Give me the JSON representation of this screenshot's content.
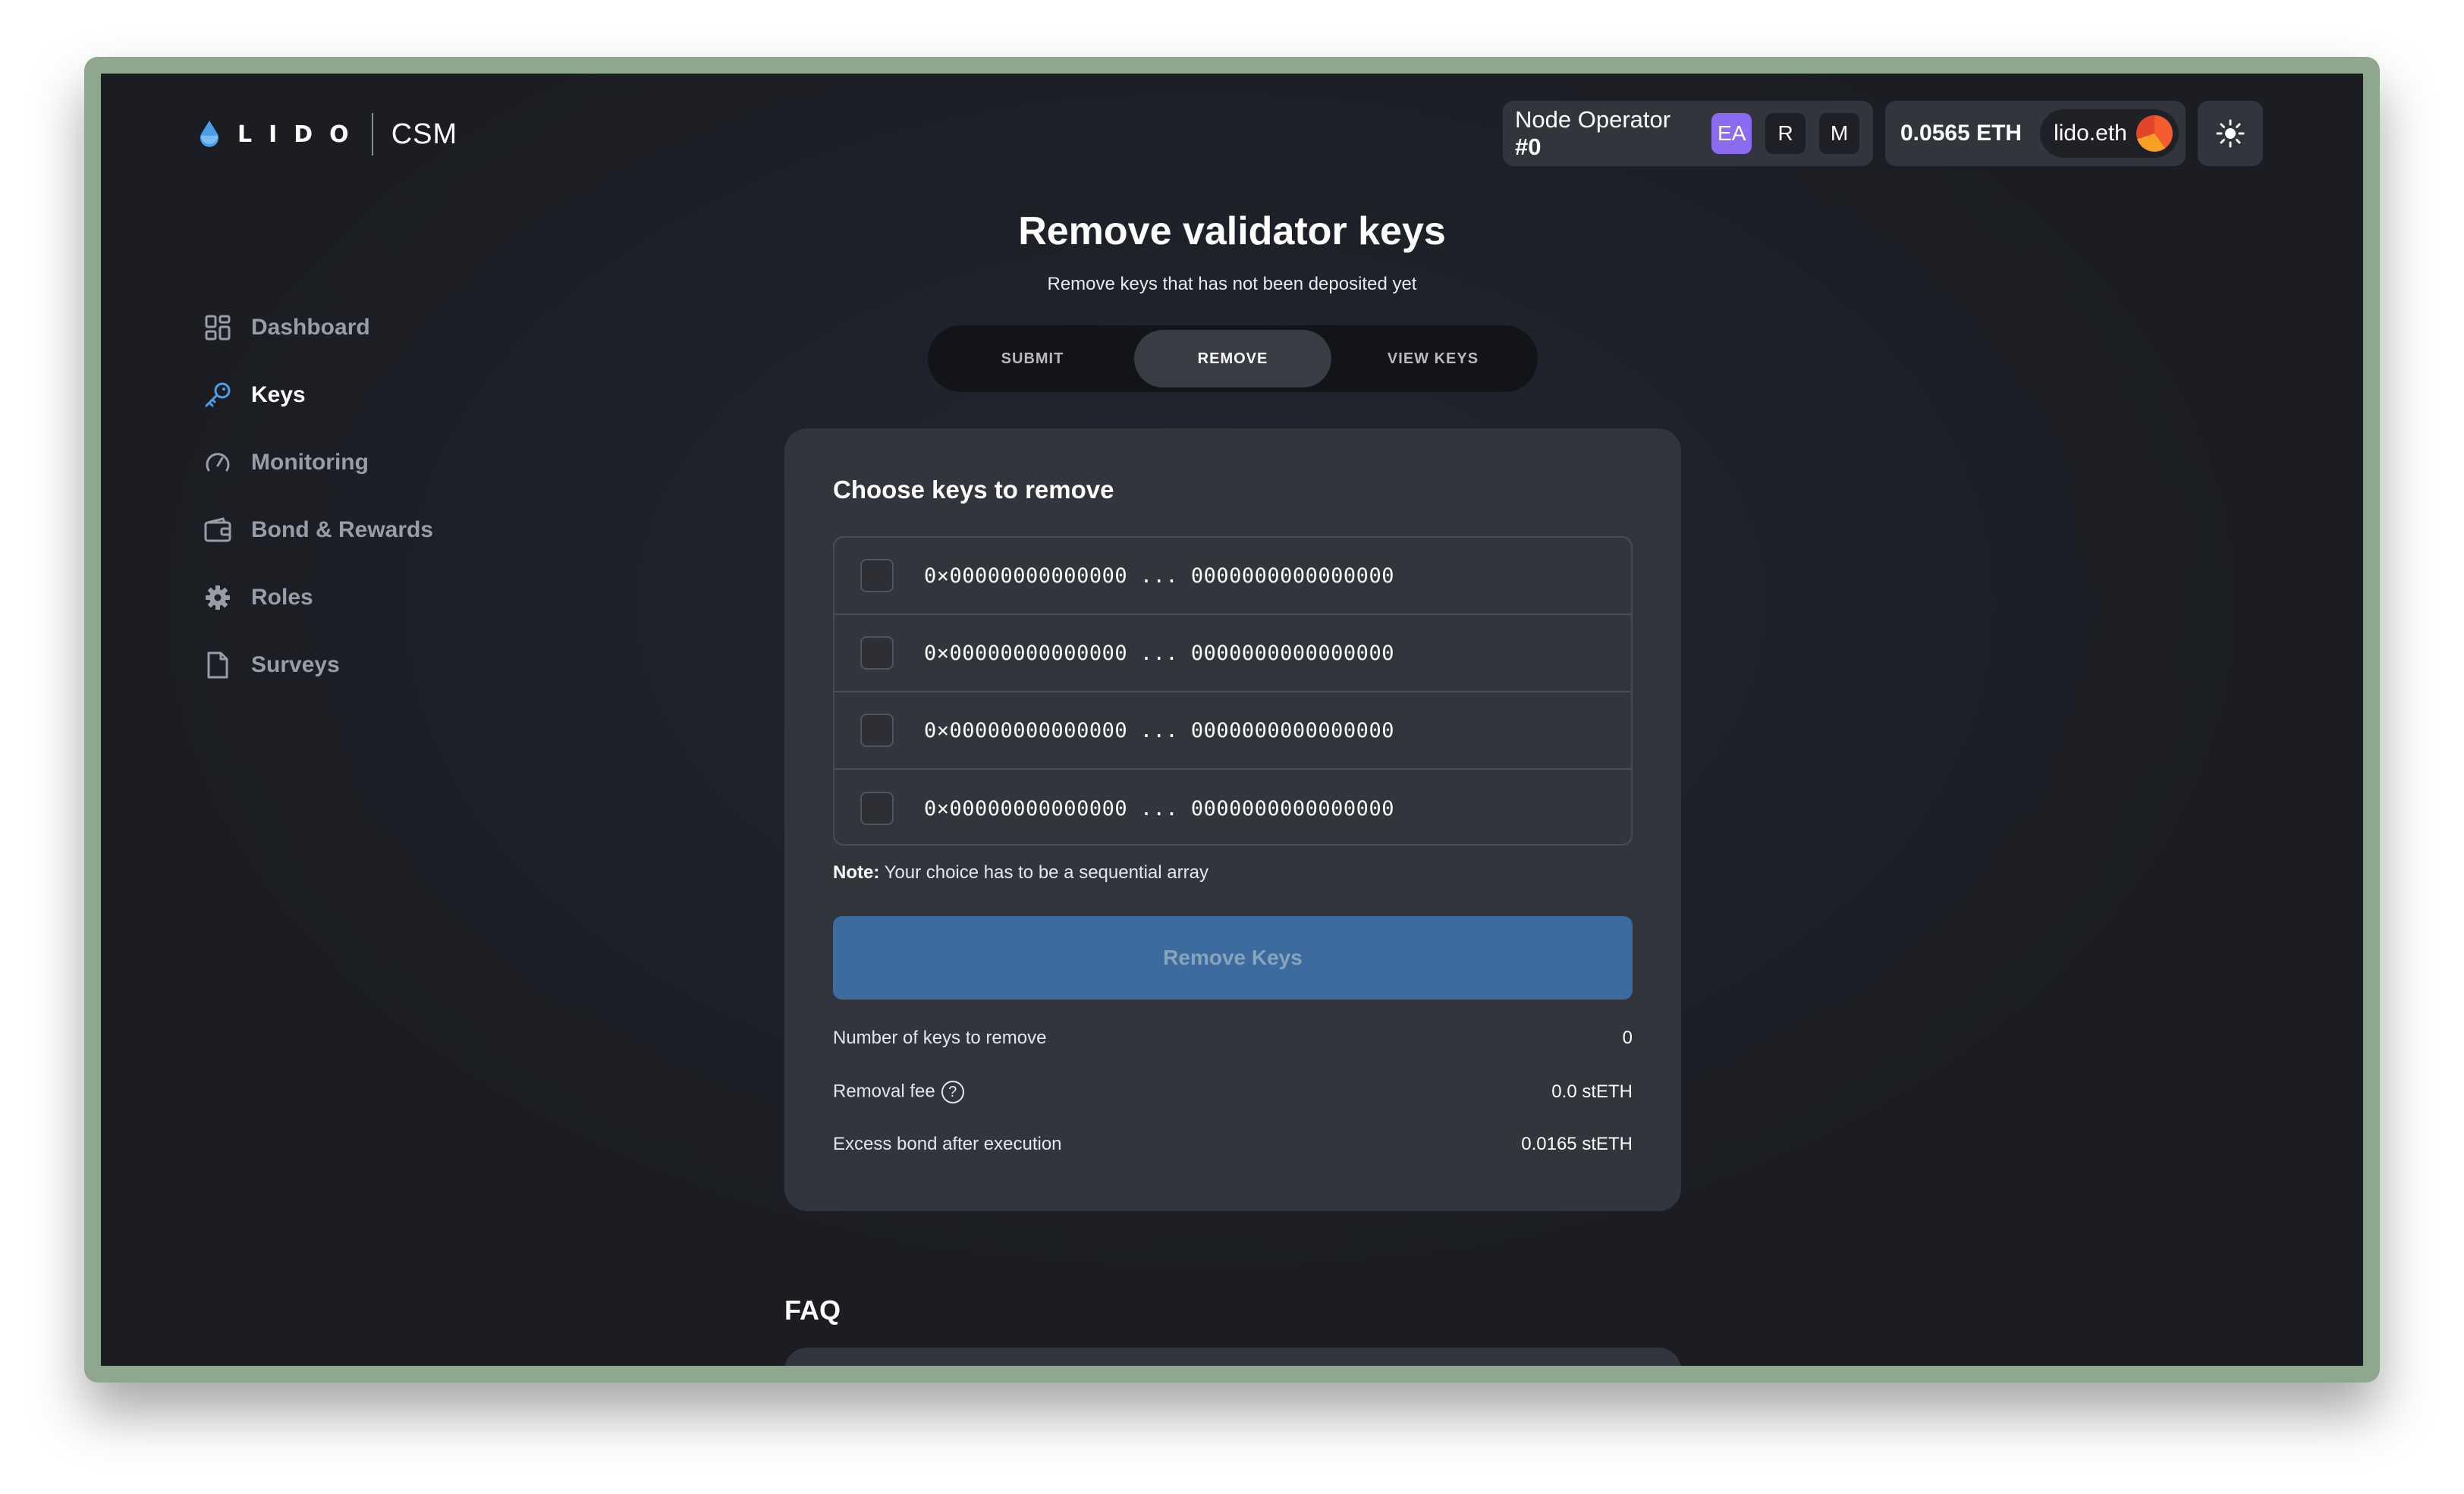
{
  "brand": {
    "logo_text": "LIDO",
    "product": "CSM"
  },
  "header": {
    "operator_label": "Node Operator",
    "operator_id": "#0",
    "roles": [
      "EA",
      "R",
      "M"
    ],
    "balance": "0.0565 ETH",
    "ens_name": "lido.eth"
  },
  "sidebar": {
    "items": [
      {
        "label": "Dashboard",
        "icon": "dashboard-icon"
      },
      {
        "label": "Keys",
        "icon": "key-icon"
      },
      {
        "label": "Monitoring",
        "icon": "gauge-icon"
      },
      {
        "label": "Bond & Rewards",
        "icon": "wallet-icon"
      },
      {
        "label": "Roles",
        "icon": "gear-icon"
      },
      {
        "label": "Surveys",
        "icon": "document-icon"
      }
    ]
  },
  "page": {
    "title": "Remove validator keys",
    "subtitle": "Remove keys that has not been deposited yet"
  },
  "tabs": [
    "SUBMIT",
    "REMOVE",
    "VIEW KEYS"
  ],
  "card": {
    "title": "Choose keys to remove",
    "keys": [
      "0×00000000000000 ... 0000000000000000",
      "0×00000000000000 ... 0000000000000000",
      "0×00000000000000 ... 0000000000000000",
      "0×00000000000000 ... 0000000000000000"
    ],
    "note_label": "Note:",
    "note_text": " Your choice has to be a sequential array",
    "button": "Remove Keys",
    "info": [
      {
        "label": "Number of keys to remove",
        "value": "0"
      },
      {
        "label": "Removal fee",
        "value": "0.0 stETH"
      },
      {
        "label": "Excess bond after execution",
        "value": "0.0165 stETH"
      }
    ]
  },
  "faq": {
    "title": "FAQ"
  },
  "colors": {
    "accent": "#3d6b9e",
    "role_ea": "#8b6cf0",
    "active_icon": "#4a9fe8"
  }
}
